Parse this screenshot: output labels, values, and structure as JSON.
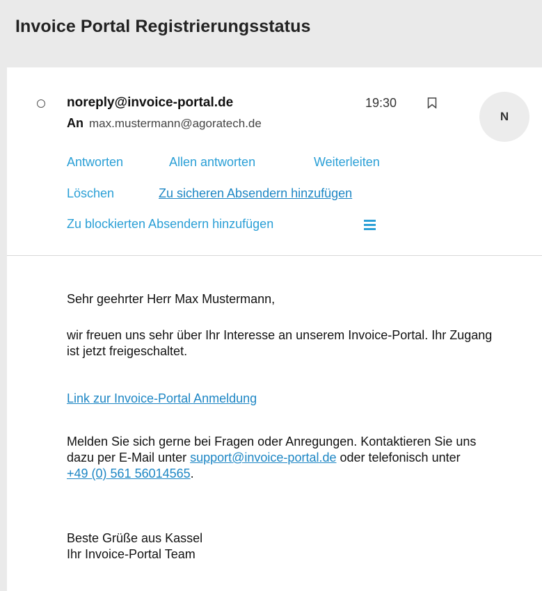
{
  "subject": "Invoice Portal Registrierungsstatus",
  "message": {
    "sender": "noreply@invoice-portal.de",
    "time": "19:30",
    "to_label": "An",
    "to_address": "max.mustermann@agoratech.de",
    "avatar_initial": "N"
  },
  "actions": {
    "reply": "Antworten",
    "reply_all": "Allen antworten",
    "forward": "Weiterleiten",
    "delete": "Löschen",
    "add_safe": "Zu sicheren Absendern hinzufügen",
    "add_blocked": "Zu blockierten Absendern hinzufügen"
  },
  "body": {
    "greeting": "Sehr geehrter Herr Max Mustermann,",
    "para1": "wir freuen uns sehr über Ihr Interesse an unserem Invoice-Portal. Ihr Zugang ist jetzt freigeschaltet.",
    "login_link": "Link zur Invoice-Portal Anmeldung",
    "para2_part1": "Melden Sie sich gerne bei Fragen oder Anregungen. Kontaktieren Sie uns dazu per E-Mail unter ",
    "support_email": "support@invoice-portal.de",
    "para2_part2": " oder telefonisch unter ",
    "phone": "+49 (0) 561 56014565",
    "para2_end": ".",
    "closing_line1": "Beste Grüße aus Kassel",
    "closing_line2": "Ihr Invoice-Portal Team"
  },
  "colors": {
    "link": "#2a9fd6",
    "background": "#eaeaea",
    "card": "#ffffff"
  },
  "icons": [
    "radio-icon",
    "bookmark-icon",
    "more-menu-icon"
  ]
}
